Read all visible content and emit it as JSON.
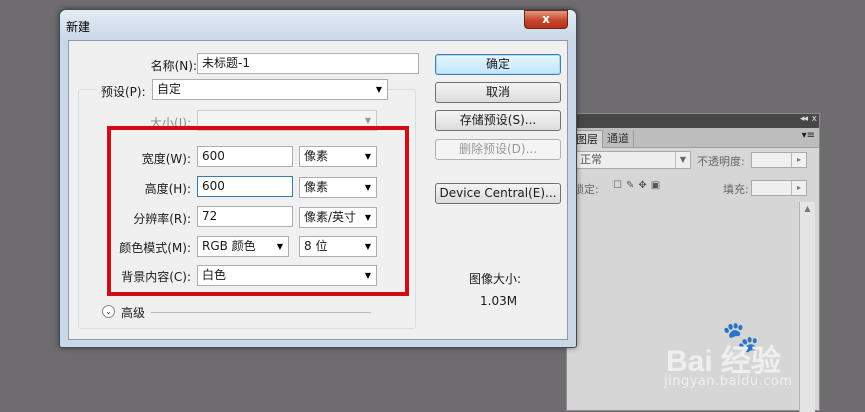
{
  "dialog": {
    "title": "新建",
    "close_glyph": "x",
    "name_label": "名称(N):",
    "name_value": "未标题-1",
    "preset_label": "预设(P):",
    "preset_value": "自定",
    "size_label": "大小(I):",
    "size_value": "",
    "width_label": "宽度(W):",
    "width_value": "600",
    "width_unit": "像素",
    "height_label": "高度(H):",
    "height_value": "600",
    "height_unit": "像素",
    "resolution_label": "分辨率(R):",
    "resolution_value": "72",
    "resolution_unit": "像素/英寸",
    "color_mode_label": "颜色模式(M):",
    "color_mode_value": "RGB 颜色",
    "bit_depth_value": "8 位",
    "background_label": "背景内容(C):",
    "background_value": "白色",
    "advanced_label": "高级",
    "image_size_label": "图像大小:",
    "image_size_value": "1.03M",
    "buttons": {
      "ok": "确定",
      "cancel": "取消",
      "save_preset": "存储预设(S)...",
      "delete_preset": "删除预设(D)...",
      "device_central": "Device Central(E)..."
    }
  },
  "layers_panel": {
    "tabs": [
      "图层",
      "通道"
    ],
    "blend_mode": "正常",
    "opacity_label": "不透明度:",
    "lock_label": "锁定:",
    "fill_label": "填充:"
  },
  "watermark": {
    "brand": "Bai  经验",
    "url": "jingyan.baidu.com"
  },
  "colors": {
    "highlight": "#d40b12",
    "desktop": "#6f6c6f",
    "dialog_frame": "#c9d7e7"
  }
}
